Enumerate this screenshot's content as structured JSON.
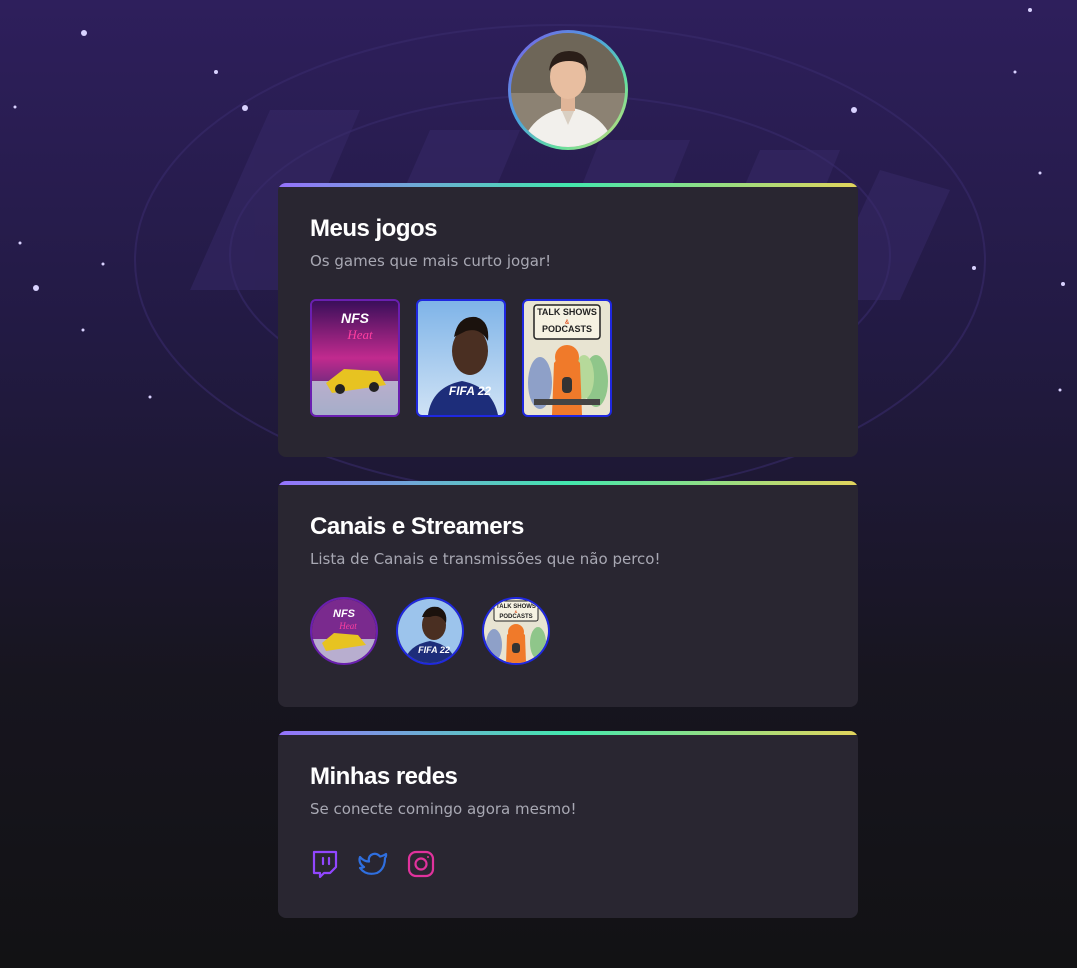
{
  "profile": {
    "avatar_alt": "Foto de perfil"
  },
  "games_card": {
    "title": "Meus jogos",
    "subtitle": "Os games que mais curto jogar!",
    "items": [
      {
        "name": "Need for Speed Heat",
        "logo_text": "NFS",
        "logo_sub": "Heat"
      },
      {
        "name": "FIFA 22",
        "logo_text": "FIFA 22"
      },
      {
        "name": "Talk Shows & Podcasts",
        "logo_text": "TALK SHOWS",
        "logo_amp": "&",
        "logo_sub": "PODCASTS"
      }
    ]
  },
  "channels_card": {
    "title": "Canais e Streamers",
    "subtitle": "Lista de Canais e transmissões que não perco!",
    "items": [
      {
        "name": "Need for Speed Heat",
        "logo_text": "NFS",
        "logo_sub": "Heat"
      },
      {
        "name": "FIFA 22",
        "logo_text": "FIFA 22"
      },
      {
        "name": "Talk Shows & Podcasts",
        "logo_text": "TALK SHOWS",
        "logo_amp": "&",
        "logo_sub": "PODCASTS"
      }
    ]
  },
  "socials_card": {
    "title": "Minhas redes",
    "subtitle": "Se conecte comingo agora mesmo!",
    "links": [
      {
        "name": "Twitch",
        "icon": "twitch-icon",
        "color": "#9146ff"
      },
      {
        "name": "Twitter",
        "icon": "twitter-icon",
        "color": "#2f6fe0"
      },
      {
        "name": "Instagram",
        "icon": "instagram-icon",
        "color": "#e0329c"
      }
    ]
  },
  "colors": {
    "card_bg": "#292631",
    "title": "#ffffff",
    "subtitle": "#a8a8b3",
    "accent_gradient": [
      "#9572fc",
      "#43e7ad",
      "#e2d45c"
    ]
  }
}
